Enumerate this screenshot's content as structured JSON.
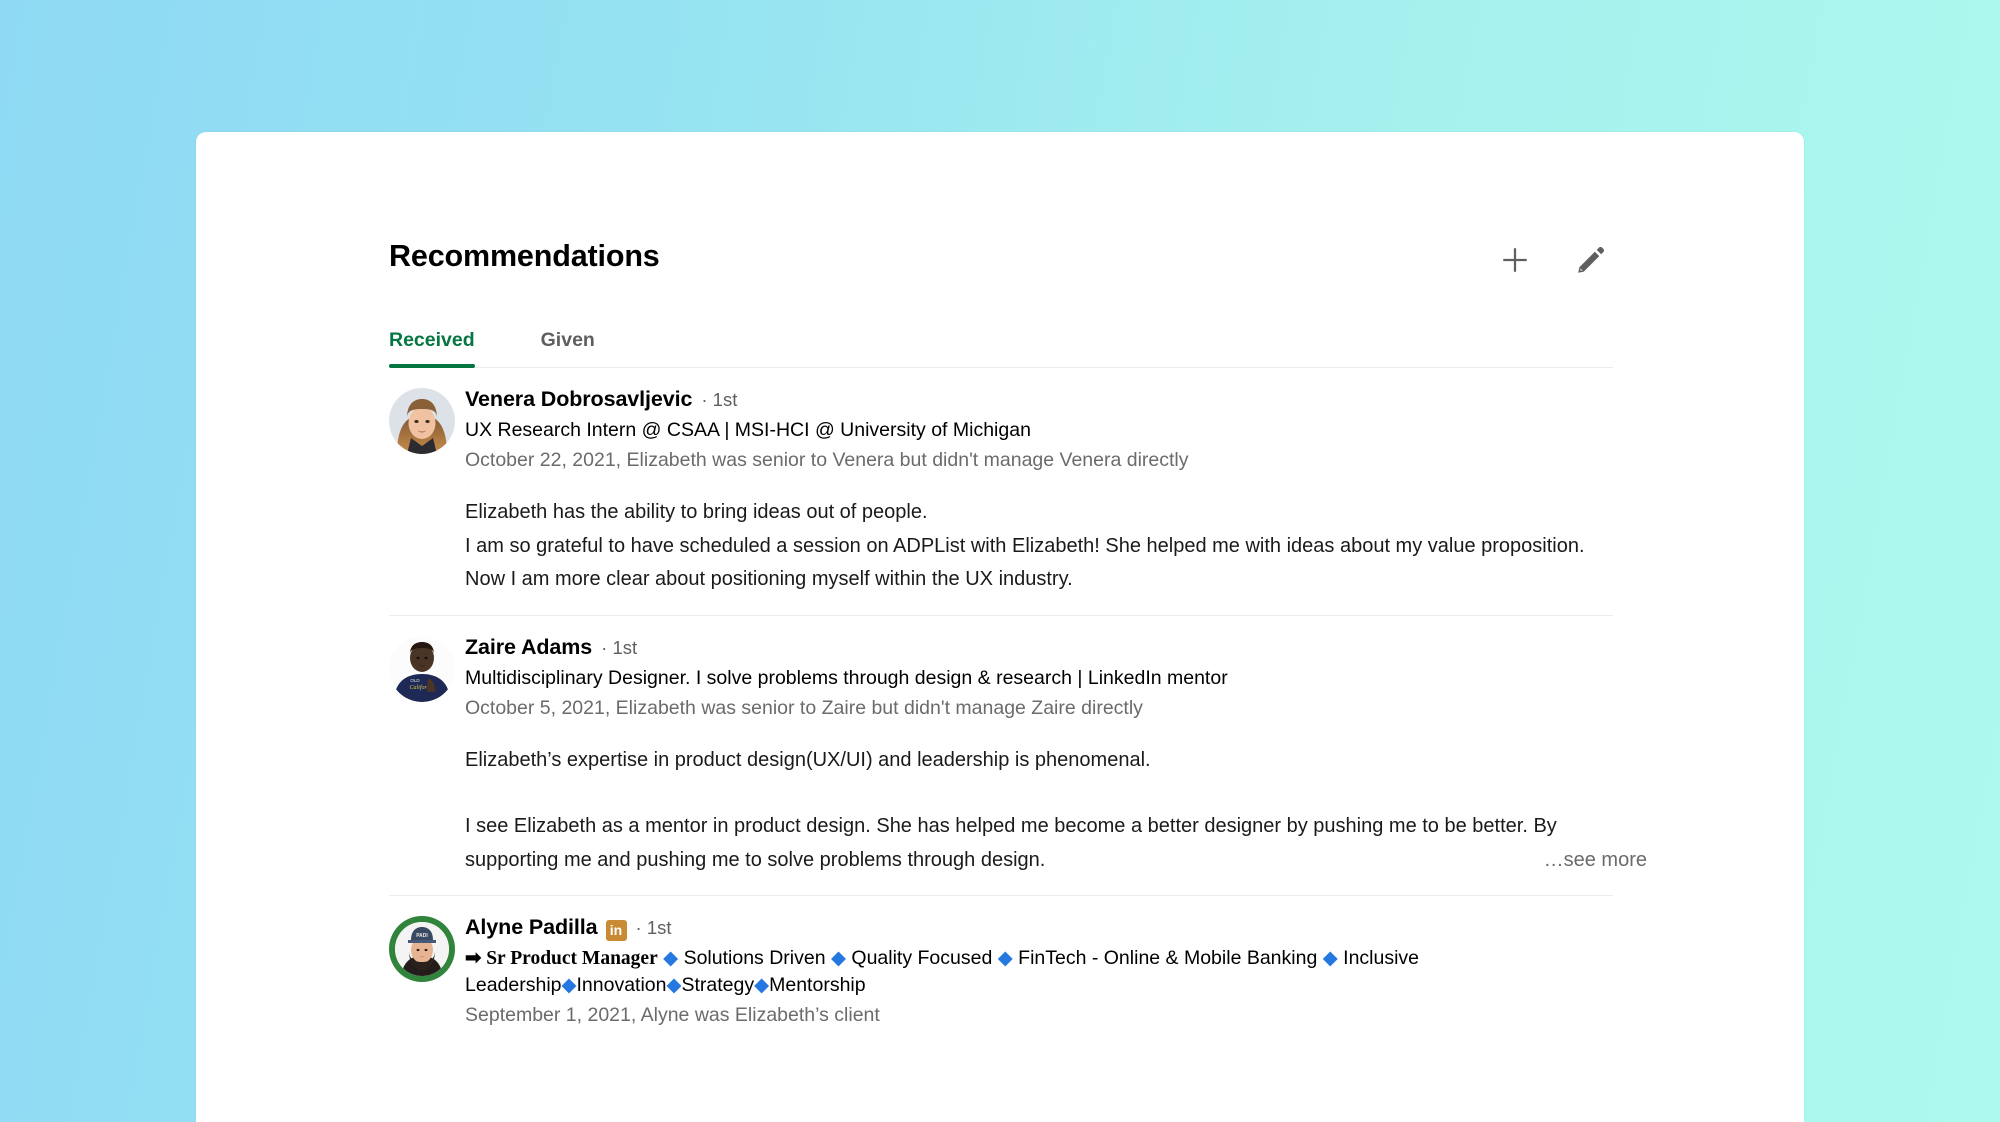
{
  "background": {
    "gradient_from": "#8FD9F4",
    "gradient_to": "#ACFAEE"
  },
  "theme": {
    "accent_green": "#057642",
    "link_blue": "#2478E0",
    "premium_badge": "#C88A32",
    "muted_text": "#6B6B6B"
  },
  "header": {
    "title": "Recommendations",
    "add_icon": "plus-icon",
    "edit_icon": "pencil-icon"
  },
  "tabs": [
    {
      "label": "Received",
      "active": true
    },
    {
      "label": "Given",
      "active": false
    }
  ],
  "recommendations": [
    {
      "name": "Venera Dobrosavljevic",
      "degree": "· 1st",
      "headline": "UX Research Intern @ CSAA | MSI-HCI @ University of Michigan",
      "meta": "October 22, 2021, Elizabeth was senior to Venera but didn't manage Venera directly",
      "body_1": "Elizabeth has the ability to bring ideas out of people.",
      "body_2": "I am so grateful to have scheduled a session on ADPList with Elizabeth! She helped me with ideas about my value proposition. Now I am more clear about positioning myself within the UX industry.",
      "premium_badge": false,
      "open_to_work_ring": false,
      "see_more": null
    },
    {
      "name": "Zaire Adams",
      "degree": "· 1st",
      "headline": "Multidisciplinary Designer. I solve problems through design & research | LinkedIn mentor",
      "meta": "October 5, 2021, Elizabeth was senior to Zaire but didn't manage Zaire directly",
      "body_1": "Elizabeth’s expertise in product design(UX/UI) and leadership is phenomenal.",
      "body_2": "I see Elizabeth as a mentor in product design. She has helped me become a better designer by pushing me to be better. By supporting me and pushing me to solve problems through design.",
      "premium_badge": false,
      "open_to_work_ring": false,
      "see_more": "…see more"
    },
    {
      "name": "Alyne Padilla",
      "degree": "· 1st",
      "headline_prefix": "➡ Sr Product Manager",
      "headline_parts": [
        "Solutions Driven",
        "Quality Focused",
        "FinTech - Online & Mobile Banking",
        "Inclusive Leadership",
        "Innovation",
        "Strategy",
        "Mentorship"
      ],
      "headline_separator": "◆",
      "meta": "September 1, 2021, Alyne was Elizabeth’s client",
      "premium_badge": true,
      "premium_badge_text": "in",
      "open_to_work_ring": true,
      "see_more": null
    }
  ]
}
